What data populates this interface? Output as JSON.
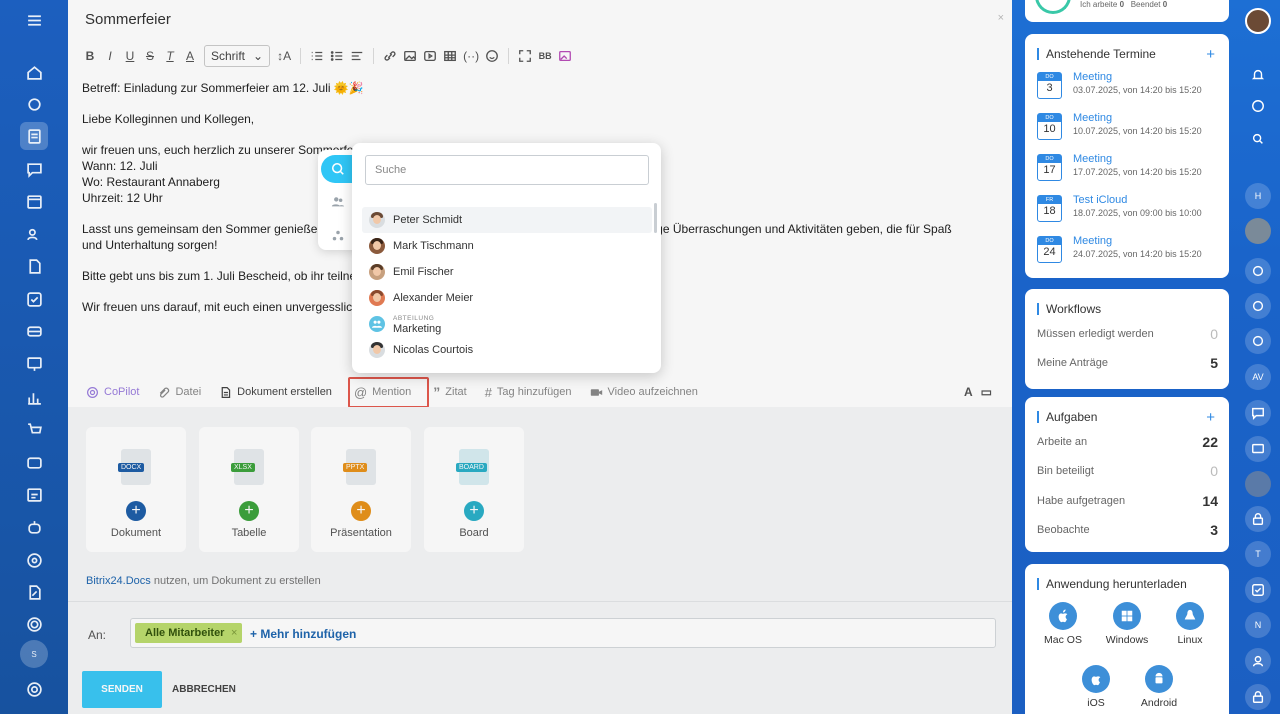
{
  "editor": {
    "title": "Sommerfeier",
    "font_select": "Schrift",
    "subject": "Betreff: Einladung zur Sommerfeier am 12. Juli 🌞🎉",
    "greeting": "Liebe Kolleginnen und Kollegen,",
    "line1": "wir freuen uns, euch herzlich zu unserer Sommerfeier e",
    "line2": "Wann: 12. Juli",
    "line3": "Wo: Restaurant Annaberg",
    "line4": "Uhrzeit: 12 Uhr",
    "para2a": "Lasst uns gemeinsam den Sommer genießen, bei",
    "para2b": "wird auch einige Überraschungen und Aktivitäten geben, die für Spaß",
    "para2c": "und Unterhaltung sorgen!",
    "para3": "Bitte gebt uns bis zum 1. Juli Bescheid, ob ihr teilnehm",
    "para4": "Wir freuen uns darauf, mit euch einen unvergesslichen"
  },
  "bottombar": {
    "copilot": "CoPilot",
    "file": "Datei",
    "create_doc": "Dokument erstellen",
    "mention": "Mention",
    "quote": "Zitat",
    "add_tag": "Tag hinzufügen",
    "record_video": "Video aufzeichnen",
    "font_a": "A"
  },
  "files": {
    "cards": [
      {
        "tag": "DOCX",
        "label": "Dokument"
      },
      {
        "tag": "XLSX",
        "label": "Tabelle"
      },
      {
        "tag": "PPTX",
        "label": "Präsentation"
      },
      {
        "tag": "BOARD",
        "label": "Board"
      }
    ],
    "hint_link": "Bitrix24.Docs",
    "hint_text": " nutzen, um Dokument zu erstellen"
  },
  "recipients": {
    "label": "An:",
    "tag": "Alle Mitarbeiter",
    "tag_close": "×",
    "add_more": "+ Mehr hinzufügen",
    "send": "SENDEN",
    "cancel": "ABBRECHEN"
  },
  "mention_popup": {
    "search_placeholder": "Suche",
    "items": [
      {
        "name": "Peter Schmidt"
      },
      {
        "name": "Mark Tischmann"
      },
      {
        "name": "Emil Fischer"
      },
      {
        "name": "Alexander Meier"
      },
      {
        "kind": "ABTEILUNG",
        "name": "Marketing"
      },
      {
        "name": "Nicolas Courtois"
      }
    ]
  },
  "right": {
    "top_status_a": "Ich arbeite",
    "top_status_a_n": "0",
    "top_status_b": "Beendet",
    "top_status_b_n": "0",
    "appointments_title": "Anstehende Termine",
    "appointments": [
      {
        "dow": "DO",
        "day": "3",
        "title": "Meeting",
        "time": "03.07.2025, von 14:20 bis 15:20"
      },
      {
        "dow": "DO",
        "day": "10",
        "title": "Meeting",
        "time": "10.07.2025, von 14:20 bis 15:20"
      },
      {
        "dow": "DO",
        "day": "17",
        "title": "Meeting",
        "time": "17.07.2025, von 14:20 bis 15:20"
      },
      {
        "dow": "FR",
        "day": "18",
        "title": "Test iCloud",
        "time": "18.07.2025, von 09:00 bis 10:00"
      },
      {
        "dow": "DO",
        "day": "24",
        "title": "Meeting",
        "time": "24.07.2025, von 14:20 bis 15:20"
      }
    ],
    "workflows_title": "Workflows",
    "workflows": [
      {
        "label": "Müssen erledigt werden",
        "n": "0"
      },
      {
        "label": "Meine Anträge",
        "n": "5"
      }
    ],
    "tasks_title": "Aufgaben",
    "tasks": [
      {
        "label": "Arbeite an",
        "n": "22"
      },
      {
        "label": "Bin beteiligt",
        "n": "0"
      },
      {
        "label": "Habe aufgetragen",
        "n": "14"
      },
      {
        "label": "Beobachte",
        "n": "3"
      }
    ],
    "download_title": "Anwendung herunterladen",
    "downloads": [
      "Mac OS",
      "Windows",
      "Linux",
      "iOS",
      "Android"
    ]
  },
  "rail_letters": {
    "h": "H",
    "av": "AV",
    "t": "T",
    "n": "N",
    "s": "S"
  }
}
